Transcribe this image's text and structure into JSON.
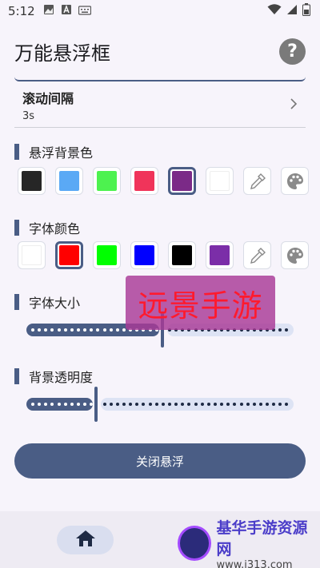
{
  "status_bar": {
    "time": "5:12"
  },
  "app_bar": {
    "title": "万能悬浮框",
    "help_icon": "help-circle-icon"
  },
  "scroll_interval": {
    "label": "滚动间隔",
    "value": "3s"
  },
  "bg_color": {
    "label": "悬浮背景色",
    "swatches": [
      "#262626",
      "#5aa9f5",
      "#4df24f",
      "#f0345a",
      "#7b2a87",
      "#ffffff"
    ],
    "selected_index": 4
  },
  "font_color": {
    "label": "字体颜色",
    "swatches": [
      "#ffffff",
      "#ff0000",
      "#00ff00",
      "#0000ff",
      "#000000",
      "#7b2ea8"
    ],
    "selected_index": 1
  },
  "font_size": {
    "label": "字体大小",
    "value_fraction": 0.51
  },
  "bg_opacity": {
    "label": "背景透明度",
    "value_fraction": 0.26
  },
  "close_button": {
    "label": "关闭悬浮"
  },
  "overlay": {
    "text": "远景手游"
  },
  "watermark": {
    "title": "基华手游资源网",
    "url": "www.j313.com"
  },
  "colors": {
    "accent": "#4a5d85",
    "track_inactive": "#dde3f4"
  }
}
